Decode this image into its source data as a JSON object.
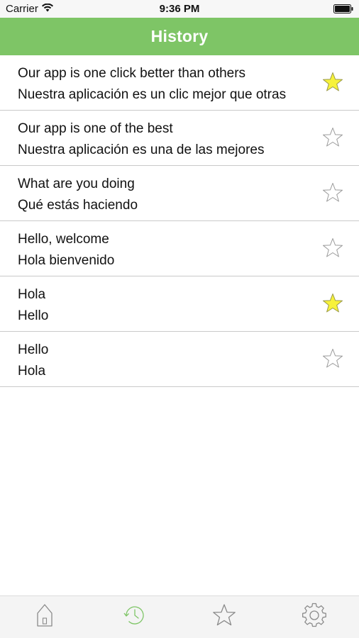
{
  "status_bar": {
    "carrier": "Carrier",
    "time": "9:36 PM"
  },
  "nav": {
    "title": "History"
  },
  "history": [
    {
      "source": "Our app is one click better than others",
      "translation": "Nuestra aplicación es un clic mejor que otras",
      "favorite": true
    },
    {
      "source": "Our app is one of the best",
      "translation": "Nuestra aplicación es una de las mejores",
      "favorite": false
    },
    {
      "source": "What are you doing",
      "translation": "Qué estás haciendo",
      "favorite": false
    },
    {
      "source": "Hello, welcome",
      "translation": "Hola bienvenido",
      "favorite": false
    },
    {
      "source": "Hola",
      "translation": "Hello",
      "favorite": true
    },
    {
      "source": "Hello",
      "translation": "Hola",
      "favorite": false
    }
  ],
  "tab_bar": {
    "tabs": [
      {
        "icon": "home-icon",
        "active": false
      },
      {
        "icon": "history-clock-icon",
        "active": true
      },
      {
        "icon": "star-icon",
        "active": false
      },
      {
        "icon": "gear-icon",
        "active": false
      }
    ]
  },
  "colors": {
    "nav_background": "#7ec566",
    "star_filled": "#f7f23a",
    "active_tab": "#7ec566",
    "inactive_tab": "#8a8a8a"
  }
}
